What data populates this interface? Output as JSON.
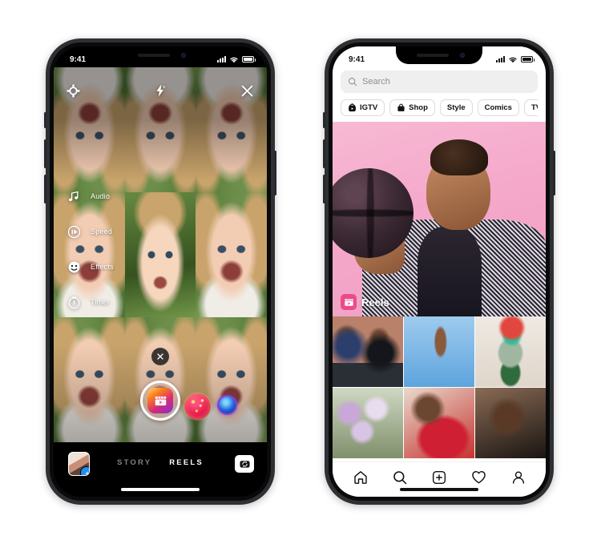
{
  "page": {
    "background": "#ffffff"
  },
  "left_phone": {
    "device_name": "iphone-reels-camera",
    "status_bar": {
      "time": "9:41",
      "cellular_icon": "signal-bars-icon",
      "wifi_icon": "wifi-icon",
      "battery_icon": "battery-full-icon"
    },
    "camera": {
      "settings_icon": "camera-settings-icon",
      "flash_icon": "flash-off-icon",
      "close_icon": "close-x-icon",
      "tools": [
        {
          "label": "Audio",
          "icon": "music-note-icon"
        },
        {
          "label": "Speed",
          "icon": "speed-gauge-icon"
        },
        {
          "label": "Effects",
          "icon": "smiley-face-icon"
        },
        {
          "label": "Timer",
          "icon": "timer-clock-icon"
        }
      ],
      "dismiss_effect_icon": "close-x-icon",
      "shutter_icon": "reels-clapper-icon",
      "effect_thumbnails": [
        {
          "name": "effect-red-glitter",
          "color": "#e8124f"
        },
        {
          "name": "effect-blue-orb",
          "color": "#1f62d8"
        }
      ]
    },
    "bottom_bar": {
      "gallery_icon": "gallery-thumbnail",
      "gallery_add_badge": "+",
      "modes": [
        {
          "label": "STORY",
          "selected": false
        },
        {
          "label": "REELS",
          "selected": true
        }
      ],
      "flip_camera_icon": "flip-camera-icon"
    }
  },
  "right_phone": {
    "device_name": "iphone-instagram-explore",
    "status_bar": {
      "time": "9:41",
      "cellular_icon": "signal-bars-icon",
      "wifi_icon": "wifi-icon",
      "battery_icon": "battery-full-icon"
    },
    "search": {
      "placeholder": "Search",
      "value": "",
      "icon": "search-icon"
    },
    "chips": [
      {
        "label": "IGTV",
        "icon": "igtv-icon"
      },
      {
        "label": "Shop",
        "icon": "shopping-bag-icon"
      },
      {
        "label": "Style",
        "icon": ""
      },
      {
        "label": "Comics",
        "icon": ""
      },
      {
        "label": "TV & Movies",
        "icon": ""
      }
    ],
    "hero": {
      "label": "Reels",
      "badge_icon": "reels-clapper-icon",
      "background": "#f5a8ca"
    },
    "grid_tiles": [
      {
        "name": "tile-two-people-desk"
      },
      {
        "name": "tile-glitter-hand-sky"
      },
      {
        "name": "tile-colorful-outfit"
      },
      {
        "name": "tile-flowers"
      },
      {
        "name": "tile-red-portrait"
      },
      {
        "name": "tile-dark-portrait"
      }
    ],
    "tabbar": [
      {
        "name": "home",
        "icon": "home-icon"
      },
      {
        "name": "search",
        "icon": "search-icon"
      },
      {
        "name": "create",
        "icon": "plus-square-icon"
      },
      {
        "name": "activity",
        "icon": "heart-icon"
      },
      {
        "name": "profile",
        "icon": "person-icon"
      }
    ]
  }
}
